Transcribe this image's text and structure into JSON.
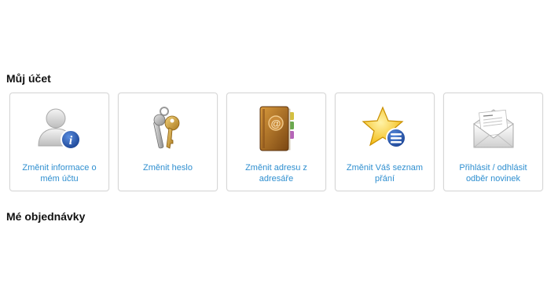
{
  "account": {
    "title": "Můj účet",
    "tiles": [
      {
        "label": "Změnit informace o mém účtu",
        "icon": "user-info-icon"
      },
      {
        "label": "Změnit heslo",
        "icon": "keys-icon"
      },
      {
        "label": "Změnit adresu z adresáře",
        "icon": "address-book-icon"
      },
      {
        "label": "Změnit Váš seznam přání",
        "icon": "star-list-icon"
      },
      {
        "label": "Přihlásit / odhlásit odběr novinek",
        "icon": "newsletter-envelope-icon"
      }
    ]
  },
  "orders": {
    "title": "Mé objednávky"
  }
}
